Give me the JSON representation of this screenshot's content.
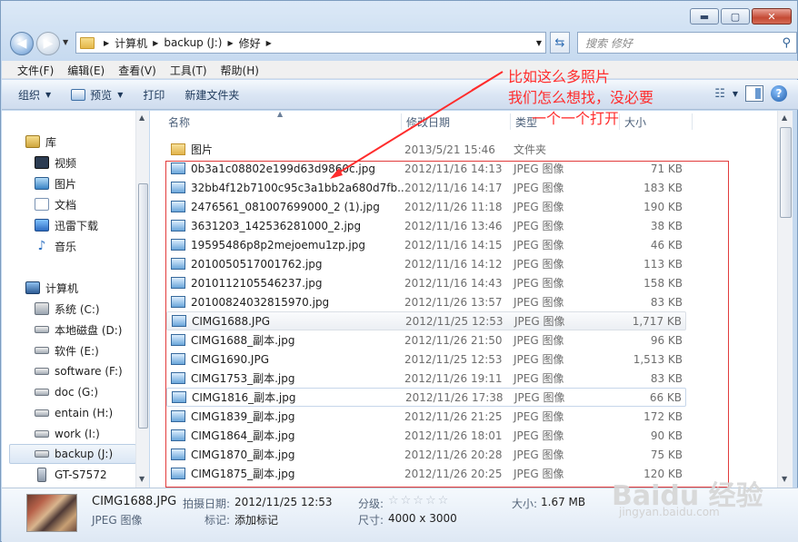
{
  "window": {
    "caption_buttons": {
      "minimize": "▬",
      "maximize": "▢",
      "close": "✕"
    }
  },
  "navigation": {
    "breadcrumb": [
      "计算机",
      "backup (J:)",
      "修好"
    ],
    "search_placeholder": "搜索 修好"
  },
  "menu": [
    "文件(F)",
    "编辑(E)",
    "查看(V)",
    "工具(T)",
    "帮助(H)"
  ],
  "toolbar": {
    "organize": "组织",
    "preview": "预览",
    "print": "打印",
    "new_folder": "新建文件夹"
  },
  "sidebar": {
    "library": {
      "label": "库",
      "items": [
        "视频",
        "图片",
        "文档",
        "迅雷下载",
        "音乐"
      ]
    },
    "computer": {
      "label": "计算机",
      "items": [
        "系统 (C:)",
        "本地磁盘 (D:)",
        "软件 (E:)",
        "software (F:)",
        "doc (G:)",
        "entain (H:)",
        "work (I:)",
        "backup (J:)",
        "GT-S7572"
      ]
    }
  },
  "columns": {
    "name": "名称",
    "date": "修改日期",
    "type": "类型",
    "size": "大小"
  },
  "files": [
    {
      "name": "图片",
      "date": "2013/5/21 15:46",
      "type": "文件夹",
      "size": "",
      "icon": "folder-icon"
    },
    {
      "name": "0b3a1c08802e199d63d9860c.jpg",
      "date": "2012/11/16 14:13",
      "type": "JPEG 图像",
      "size": "71 KB",
      "icon": "image-file-icon"
    },
    {
      "name": "32bb4f12b7100c95c3a1bb2a680d7fb...",
      "date": "2012/11/16 14:17",
      "type": "JPEG 图像",
      "size": "183 KB",
      "icon": "image-file-icon"
    },
    {
      "name": "2476561_081007699000_2 (1).jpg",
      "date": "2012/11/26 11:18",
      "type": "JPEG 图像",
      "size": "190 KB",
      "icon": "image-file-icon"
    },
    {
      "name": "3631203_142536281000_2.jpg",
      "date": "2012/11/16 13:46",
      "type": "JPEG 图像",
      "size": "38 KB",
      "icon": "image-file-icon"
    },
    {
      "name": "19595486p8p2mejoemu1zp.jpg",
      "date": "2012/11/16 14:15",
      "type": "JPEG 图像",
      "size": "46 KB",
      "icon": "image-file-icon"
    },
    {
      "name": "2010050517001762.jpg",
      "date": "2012/11/16 14:12",
      "type": "JPEG 图像",
      "size": "113 KB",
      "icon": "image-file-icon"
    },
    {
      "name": "2010112105546237.jpg",
      "date": "2012/11/16 14:43",
      "type": "JPEG 图像",
      "size": "158 KB",
      "icon": "image-file-icon"
    },
    {
      "name": "20100824032815970.jpg",
      "date": "2012/11/26 13:57",
      "type": "JPEG 图像",
      "size": "83 KB",
      "icon": "image-file-icon"
    },
    {
      "name": "CIMG1688.JPG",
      "date": "2012/11/25 12:53",
      "type": "JPEG 图像",
      "size": "1,717 KB",
      "icon": "image-file-icon"
    },
    {
      "name": "CIMG1688_副本.jpg",
      "date": "2012/11/26 21:50",
      "type": "JPEG 图像",
      "size": "96 KB",
      "icon": "image-file-icon"
    },
    {
      "name": "CIMG1690.JPG",
      "date": "2012/11/25 12:53",
      "type": "JPEG 图像",
      "size": "1,513 KB",
      "icon": "image-file-icon"
    },
    {
      "name": "CIMG1753_副本.jpg",
      "date": "2012/11/26 19:11",
      "type": "JPEG 图像",
      "size": "83 KB",
      "icon": "image-file-icon"
    },
    {
      "name": "CIMG1816_副本.jpg",
      "date": "2012/11/26 17:38",
      "type": "JPEG 图像",
      "size": "66 KB",
      "icon": "image-file-icon"
    },
    {
      "name": "CIMG1839_副本.jpg",
      "date": "2012/11/26 21:25",
      "type": "JPEG 图像",
      "size": "172 KB",
      "icon": "image-file-icon"
    },
    {
      "name": "CIMG1864_副本.jpg",
      "date": "2012/11/26 18:01",
      "type": "JPEG 图像",
      "size": "90 KB",
      "icon": "image-file-icon"
    },
    {
      "name": "CIMG1870_副本.jpg",
      "date": "2012/11/26 20:28",
      "type": "JPEG 图像",
      "size": "75 KB",
      "icon": "image-file-icon"
    },
    {
      "name": "CIMG1875_副本.jpg",
      "date": "2012/11/26 20:25",
      "type": "JPEG 图像",
      "size": "120 KB",
      "icon": "image-file-icon"
    }
  ],
  "annotation": {
    "line1": "比如这么多照片",
    "line2": "我们怎么想找，没必要",
    "line3": "一个一个打开",
    "color": "#ff2c2c"
  },
  "details": {
    "filename": "CIMG1688.JPG",
    "filetype": "JPEG 图像",
    "date_label": "拍摄日期:",
    "date_value": "2012/11/25 12:53",
    "tags_label": "标记:",
    "tags_value": "添加标记",
    "rating_label": "分级:",
    "rating_stars": "☆☆☆☆☆",
    "dims_label": "尺寸:",
    "dims_value": "4000 x 3000",
    "size_label": "大小:",
    "size_value": "1.67 MB"
  },
  "watermark": {
    "main": "Baidu 经验",
    "sub": "jingyan.baidu.com"
  }
}
